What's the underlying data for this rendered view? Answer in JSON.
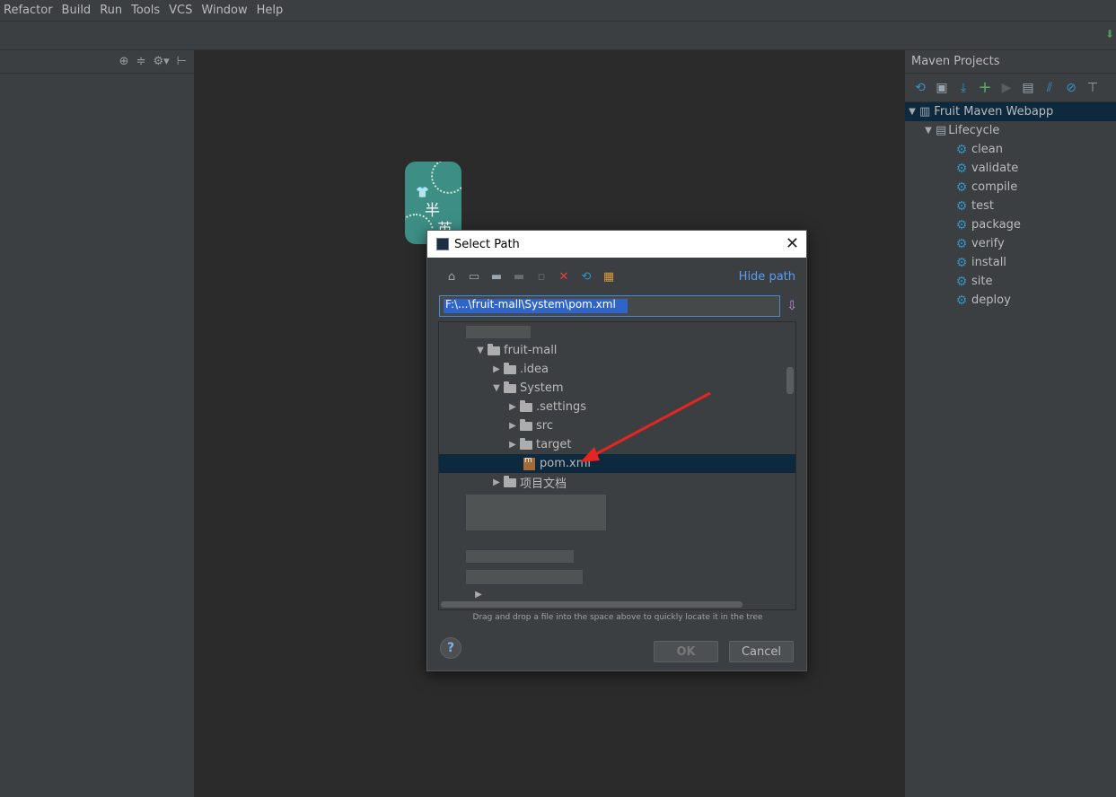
{
  "menu": [
    "Refactor",
    "Build",
    "Run",
    "Tools",
    "VCS",
    "Window",
    "Help"
  ],
  "left_panel": {
    "icons": [
      "target-icon",
      "split-icon",
      "gear-icon",
      "pin-icon"
    ]
  },
  "logo": {
    "char1": "半",
    "char2": "英"
  },
  "dialog": {
    "title": "Select Path",
    "hide_path": "Hide path",
    "path_value": "F:\\...\\fruit-mall\\System\\pom.xml",
    "tree": [
      {
        "label": "fruit-mall",
        "expanded": true
      },
      {
        "label": ".idea",
        "expanded": false
      },
      {
        "label": "System",
        "expanded": true
      },
      {
        "label": ".settings",
        "expanded": false
      },
      {
        "label": "src",
        "expanded": false
      },
      {
        "label": "target",
        "expanded": false
      },
      {
        "label": "pom.xml",
        "selected": true
      },
      {
        "label": "项目文档",
        "expanded": false
      }
    ],
    "hint": "Drag and drop a file into the space above to quickly locate it in the tree",
    "ok": "OK",
    "cancel": "Cancel",
    "help": "?"
  },
  "maven": {
    "title": "Maven Projects",
    "project": "Fruit Maven Webapp",
    "lifecycle": "Lifecycle",
    "phases": [
      "clean",
      "validate",
      "compile",
      "test",
      "package",
      "verify",
      "install",
      "site",
      "deploy"
    ]
  },
  "colors": {
    "accent": "#589df6",
    "selection": "#0d293e",
    "arrow": "#e52521"
  }
}
